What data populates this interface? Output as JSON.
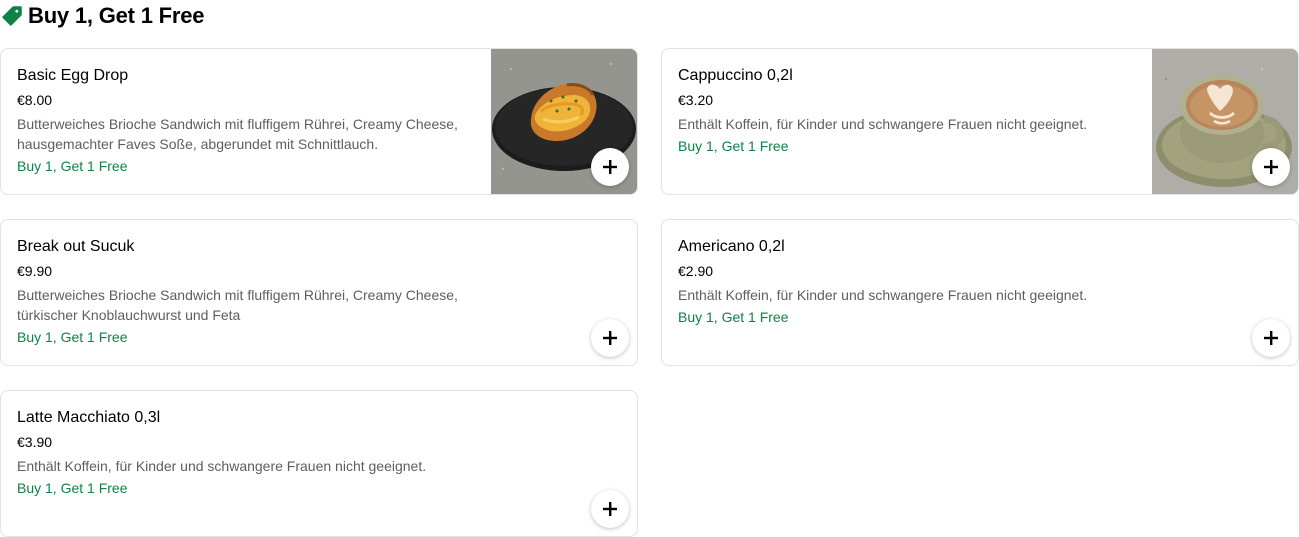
{
  "section": {
    "title": "Buy 1, Get 1 Free",
    "icon": "tag-icon",
    "accent_color": "#0e8345"
  },
  "items": [
    {
      "name": "Basic Egg Drop",
      "price": "€8.00",
      "description": "Butterweiches Brioche Sandwich mit fluffigem Rührei, Creamy Cheese, hausgemachter Faves Soße, abgerundet mit Schnittlauch.",
      "promo": "Buy 1, Get 1 Free",
      "image": "egg-sandwich-image"
    },
    {
      "name": "Cappuccino 0,2l",
      "price": "€3.20",
      "description": "Enthält Koffein, für Kinder und schwangere Frauen nicht geeignet.",
      "promo": "Buy 1, Get 1 Free",
      "image": "cappuccino-image"
    },
    {
      "name": "Break out Sucuk",
      "price": "€9.90",
      "description": "Butterweiches Brioche Sandwich mit fluffigem Rührei, Creamy Cheese, türkischer Knoblauchwurst und Feta",
      "promo": "Buy 1, Get 1 Free"
    },
    {
      "name": "Americano 0,2l",
      "price": "€2.90",
      "description": "Enthält Koffein, für Kinder und schwangere Frauen nicht geeignet.",
      "promo": "Buy 1, Get 1 Free"
    },
    {
      "name": "Latte Macchiato 0,3l",
      "price": "€3.90",
      "description": "Enthält Koffein, für Kinder und schwangere Frauen nicht geeignet.",
      "promo": "Buy 1, Get 1 Free"
    }
  ],
  "add_button_icon": "plus-icon"
}
